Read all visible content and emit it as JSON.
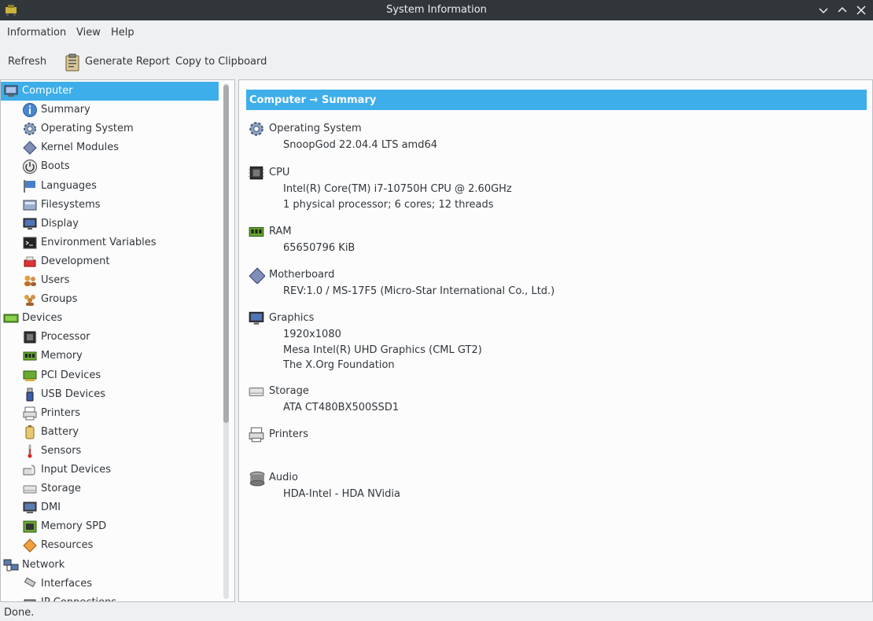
{
  "window": {
    "title": "System Information",
    "controls": [
      "minimize-icon",
      "maximize-icon",
      "close-icon"
    ]
  },
  "menubar": {
    "items": [
      "Information",
      "View",
      "Help"
    ]
  },
  "toolbar": {
    "refresh_label": "Refresh",
    "generate_report_label": "Generate Report",
    "copy_label": "Copy to Clipboard"
  },
  "sidebar": {
    "items": [
      {
        "label": "Computer",
        "icon": "computer-icon",
        "level": 0,
        "selected": true
      },
      {
        "label": "Summary",
        "icon": "info-icon",
        "level": 1
      },
      {
        "label": "Operating System",
        "icon": "gear-icon",
        "level": 1
      },
      {
        "label": "Kernel Modules",
        "icon": "kernel-module-icon",
        "level": 1
      },
      {
        "label": "Boots",
        "icon": "power-icon",
        "level": 1
      },
      {
        "label": "Languages",
        "icon": "flag-icon",
        "level": 1
      },
      {
        "label": "Filesystems",
        "icon": "filesystem-icon",
        "level": 1
      },
      {
        "label": "Display",
        "icon": "monitor-icon",
        "level": 1
      },
      {
        "label": "Environment Variables",
        "icon": "terminal-icon",
        "level": 1
      },
      {
        "label": "Development",
        "icon": "development-icon",
        "level": 1
      },
      {
        "label": "Users",
        "icon": "users-icon",
        "level": 1
      },
      {
        "label": "Groups",
        "icon": "groups-icon",
        "level": 1
      },
      {
        "label": "Devices",
        "icon": "devices-icon",
        "level": 0
      },
      {
        "label": "Processor",
        "icon": "processor-icon",
        "level": 1
      },
      {
        "label": "Memory",
        "icon": "memory-icon",
        "level": 1
      },
      {
        "label": "PCI Devices",
        "icon": "pci-icon",
        "level": 1
      },
      {
        "label": "USB Devices",
        "icon": "usb-icon",
        "level": 1
      },
      {
        "label": "Printers",
        "icon": "printer-icon",
        "level": 1
      },
      {
        "label": "Battery",
        "icon": "battery-icon",
        "level": 1
      },
      {
        "label": "Sensors",
        "icon": "thermometer-icon",
        "level": 1
      },
      {
        "label": "Input Devices",
        "icon": "input-devices-icon",
        "level": 1
      },
      {
        "label": "Storage",
        "icon": "storage-icon",
        "level": 1
      },
      {
        "label": "DMI",
        "icon": "dmi-icon",
        "level": 1
      },
      {
        "label": "Memory SPD",
        "icon": "memory-spd-icon",
        "level": 1
      },
      {
        "label": "Resources",
        "icon": "resources-icon",
        "level": 1
      },
      {
        "label": "Network",
        "icon": "network-icon",
        "level": 0
      },
      {
        "label": "Interfaces",
        "icon": "interfaces-icon",
        "level": 1
      },
      {
        "label": "IP Connections",
        "icon": "ip-connections-icon",
        "level": 1
      }
    ]
  },
  "content": {
    "header": "Computer → Summary",
    "sections": [
      {
        "name": "Operating System",
        "icon": "gear-icon",
        "lines": [
          "SnoopGod 22.04.4 LTS amd64"
        ]
      },
      {
        "name": "CPU",
        "icon": "processor-icon",
        "lines": [
          "Intel(R) Core(TM) i7-10750H CPU @ 2.60GHz",
          "1 physical processor; 6 cores; 12 threads"
        ]
      },
      {
        "name": "RAM",
        "icon": "memory-icon",
        "lines": [
          "65650796 KiB"
        ]
      },
      {
        "name": "Motherboard",
        "icon": "motherboard-icon",
        "lines": [
          "REV:1.0 / MS-17F5 (Micro-Star International Co., Ltd.)"
        ]
      },
      {
        "name": "Graphics",
        "icon": "monitor-icon",
        "lines": [
          "1920x1080",
          "Mesa Intel(R) UHD Graphics (CML GT2)",
          "The X.Org Foundation"
        ]
      },
      {
        "name": "Storage",
        "icon": "storage-icon",
        "lines": [
          "ATA CT480BX500SSD1"
        ]
      },
      {
        "name": "Printers",
        "icon": "printer-icon",
        "lines": []
      },
      {
        "name": "Audio",
        "icon": "audio-icon",
        "lines": [
          "HDA-Intel - HDA NVidia"
        ]
      }
    ]
  },
  "status": {
    "text": "Done."
  },
  "colors": {
    "accent": "#3daee9",
    "titlebar": "#31363b",
    "window_bg": "#eff0f1",
    "pane_bg": "#fcfcfc"
  }
}
